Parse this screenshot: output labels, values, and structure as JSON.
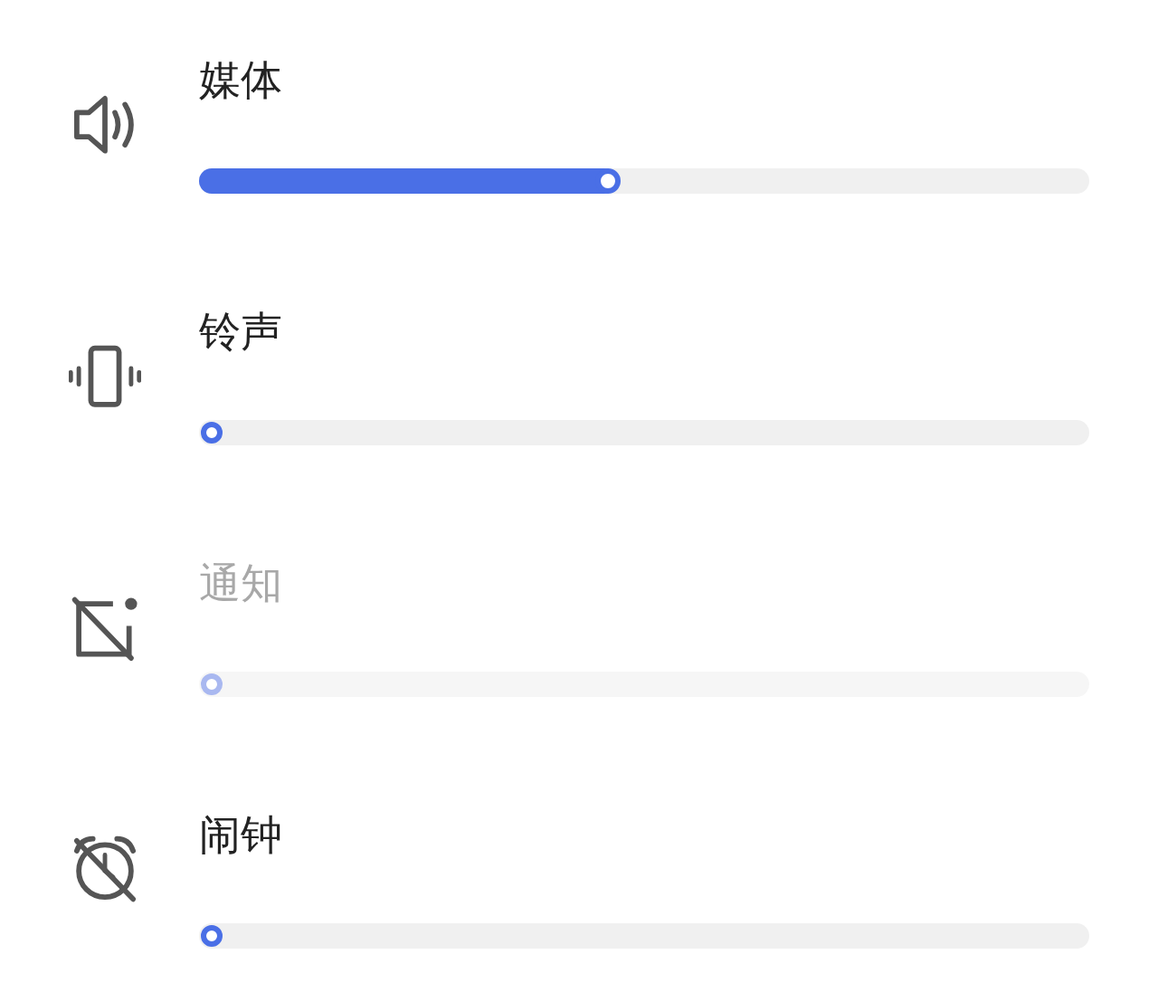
{
  "volume_sliders": [
    {
      "kind": "speaker",
      "label": "媒体",
      "level": 0.47,
      "disabled": false
    },
    {
      "kind": "vibrate",
      "label": "铃声",
      "level": 0,
      "disabled": false
    },
    {
      "kind": "notification-off",
      "label": "通知",
      "level": 0,
      "disabled": true
    },
    {
      "kind": "alarm-off",
      "label": "闹钟",
      "level": 0,
      "disabled": false
    }
  ]
}
